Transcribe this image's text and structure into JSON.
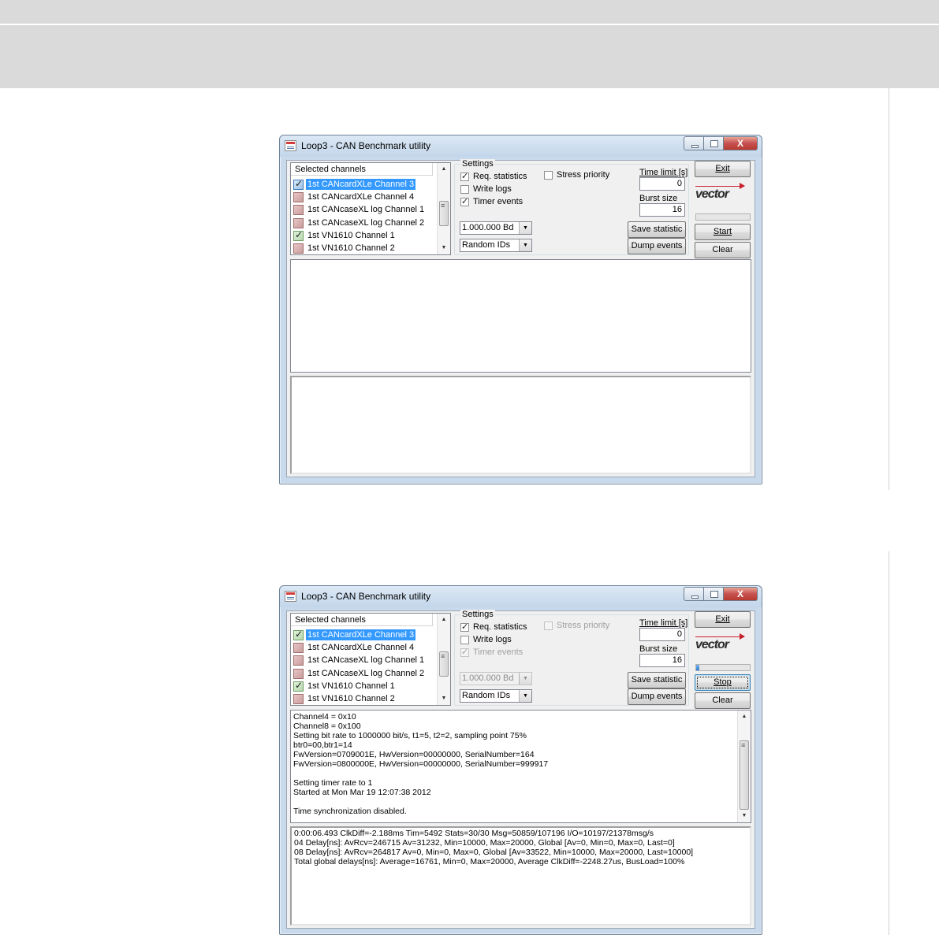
{
  "windows": [
    {
      "title": "Loop3 - CAN Benchmark utility",
      "close_glyph": "X",
      "channel_list": {
        "header": "Selected channels",
        "items": [
          {
            "label": "1st CANcardXLe Channel 3",
            "checked": true,
            "color": "blue",
            "selected": true
          },
          {
            "label": "1st CANcardXLe Channel 4",
            "checked": false,
            "color": "red",
            "selected": false
          },
          {
            "label": "1st CANcaseXL log Channel 1",
            "checked": false,
            "color": "red",
            "selected": false
          },
          {
            "label": "1st CANcaseXL log Channel 2",
            "checked": false,
            "color": "red",
            "selected": false
          },
          {
            "label": "1st VN1610 Channel 1",
            "checked": true,
            "color": "green",
            "selected": false
          },
          {
            "label": "1st VN1610 Channel 2",
            "checked": false,
            "color": "red",
            "selected": false
          }
        ]
      },
      "settings": {
        "legend": "Settings",
        "req_statistics": {
          "label": "Req. statistics",
          "checked": true,
          "enabled": true
        },
        "write_logs": {
          "label": "Write logs",
          "checked": false,
          "enabled": true
        },
        "timer_events": {
          "label": "Timer events",
          "checked": true,
          "enabled": true
        },
        "stress_priority": {
          "label": "Stress priority",
          "checked": false,
          "enabled": true
        },
        "time_limit_label": "Time limit [s]",
        "time_limit_value": "0",
        "burst_size_label": "Burst size",
        "burst_size_value": "16",
        "bitrate": {
          "value": "1.000.000 Bd",
          "enabled": true
        },
        "id_mode": {
          "value": "Random IDs",
          "enabled": true
        },
        "save_statistic_label": "Save statistic",
        "dump_events_label": "Dump events"
      },
      "buttons": {
        "exit": "Exit",
        "start_stop": "Start",
        "clear": "Clear"
      },
      "logo": "vector",
      "progress": 0.0,
      "output_log": [],
      "statistics_log": []
    },
    {
      "title": "Loop3 - CAN Benchmark utility",
      "close_glyph": "X",
      "channel_list": {
        "header": "Selected channels",
        "items": [
          {
            "label": "1st CANcardXLe Channel 3",
            "checked": true,
            "color": "green",
            "selected": true
          },
          {
            "label": "1st CANcardXLe Channel 4",
            "checked": false,
            "color": "red",
            "selected": false
          },
          {
            "label": "1st CANcaseXL log Channel 1",
            "checked": false,
            "color": "red",
            "selected": false
          },
          {
            "label": "1st CANcaseXL log Channel 2",
            "checked": false,
            "color": "red",
            "selected": false
          },
          {
            "label": "1st VN1610 Channel 1",
            "checked": true,
            "color": "green",
            "selected": false
          },
          {
            "label": "1st VN1610 Channel 2",
            "checked": false,
            "color": "red",
            "selected": false
          }
        ]
      },
      "settings": {
        "legend": "Settings",
        "req_statistics": {
          "label": "Req. statistics",
          "checked": true,
          "enabled": true
        },
        "write_logs": {
          "label": "Write logs",
          "checked": false,
          "enabled": true
        },
        "timer_events": {
          "label": "Timer events",
          "checked": true,
          "enabled": false
        },
        "stress_priority": {
          "label": "Stress priority",
          "checked": false,
          "enabled": false
        },
        "time_limit_label": "Time limit [s]",
        "time_limit_value": "0",
        "burst_size_label": "Burst size",
        "burst_size_value": "16",
        "bitrate": {
          "value": "1.000.000 Bd",
          "enabled": false
        },
        "id_mode": {
          "value": "Random IDs",
          "enabled": true
        },
        "save_statistic_label": "Save statistic",
        "dump_events_label": "Dump events"
      },
      "buttons": {
        "exit": "Exit",
        "start_stop": "Stop",
        "clear": "Clear"
      },
      "logo": "vector",
      "progress": 0.06,
      "output_log": [
        "Channel4 = 0x10",
        "Channel8 = 0x100",
        "Setting bit rate to 1000000 bit/s, t1=5, t2=2, sampling point 75%",
        "btr0=00,btr1=14",
        "FwVersion=0709001E, HwVersion=00000000, SerialNumber=164",
        "FwVersion=0800000E, HwVersion=00000000, SerialNumber=999917",
        "",
        "Setting timer rate to 1",
        "Started at Mon Mar 19 12:07:38 2012",
        "",
        "Time synchronization disabled."
      ],
      "statistics_log": [
        "0:00:06.493 ClkDiff=-2.188ms Tim=5492 Stats=30/30 Msg=50859/107196 I/O=10197/21378msg/s",
        "04 Delay[ns]: AvRcv=246715 Av=31232, Min=10000, Max=20000, Global [Av=0, Min=0, Max=0, Last=0]",
        "08 Delay[ns]: AvRcv=264817 Av=0, Min=0, Max=0, Global [Av=33522, Min=10000, Max=20000, Last=10000]",
        "Total global delays[ns]: Average=16761, Min=0, Max=20000, Average ClkDiff=-2248.27us, BusLoad=100%"
      ]
    }
  ]
}
